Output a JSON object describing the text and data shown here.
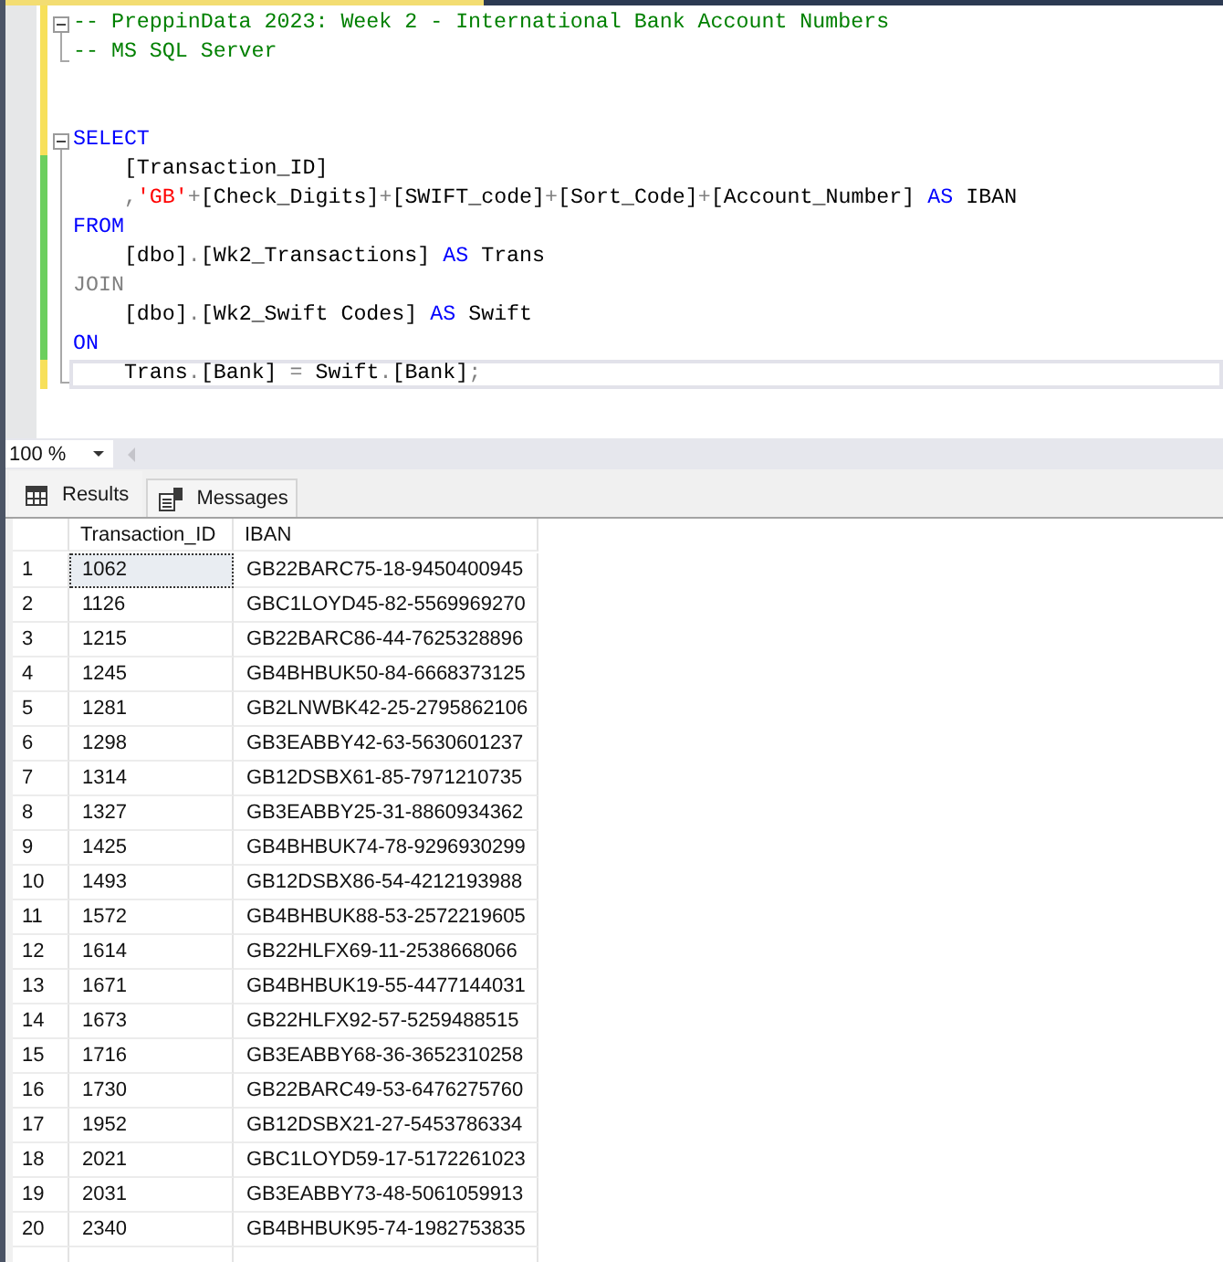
{
  "editor": {
    "blocks": [
      {
        "expanded": true,
        "lines": [
          {
            "saved": false,
            "current": false,
            "tokens": [
              {
                "kind": "comment",
                "text": "-- PreppinData 2023: Week 2 - International Bank Account Numbers"
              }
            ]
          },
          {
            "saved": false,
            "current": false,
            "tokens": [
              {
                "kind": "comment",
                "text": "-- MS SQL Server"
              }
            ]
          }
        ]
      },
      {
        "lines": [
          {
            "saved": false
          },
          {
            "saved": false
          }
        ]
      },
      {
        "expanded": true,
        "lines": [
          {
            "saved": false,
            "current": false,
            "tokens": [
              {
                "kind": "keyword",
                "text": "SELECT"
              }
            ]
          },
          {
            "saved": true,
            "current": false,
            "tokens": [
              {
                "kind": "identifier",
                "text": "    [Transaction_ID]"
              }
            ]
          },
          {
            "saved": true,
            "current": false,
            "tokens": [
              {
                "kind": "operator",
                "text": "    ,"
              },
              {
                "kind": "string",
                "text": "'GB'"
              },
              {
                "kind": "operator",
                "text": "+"
              },
              {
                "kind": "identifier",
                "text": "[Check_Digits]"
              },
              {
                "kind": "operator",
                "text": "+"
              },
              {
                "kind": "identifier",
                "text": "[SWIFT_code]"
              },
              {
                "kind": "operator",
                "text": "+"
              },
              {
                "kind": "identifier",
                "text": "[Sort_Code]"
              },
              {
                "kind": "operator",
                "text": "+"
              },
              {
                "kind": "identifier",
                "text": "[Account_Number] "
              },
              {
                "kind": "keyword",
                "text": "AS"
              },
              {
                "kind": "identifier",
                "text": " IBAN"
              }
            ]
          },
          {
            "saved": true,
            "current": false,
            "tokens": [
              {
                "kind": "keyword",
                "text": "FROM"
              }
            ]
          },
          {
            "saved": true,
            "current": false,
            "tokens": [
              {
                "kind": "identifier",
                "text": "    [dbo]"
              },
              {
                "kind": "operator",
                "text": "."
              },
              {
                "kind": "identifier",
                "text": "[Wk2_Transactions] "
              },
              {
                "kind": "keyword",
                "text": "AS"
              },
              {
                "kind": "identifier",
                "text": " Trans"
              }
            ]
          },
          {
            "saved": true,
            "current": false,
            "tokens": [
              {
                "kind": "operator",
                "text": "JOIN"
              }
            ]
          },
          {
            "saved": true,
            "current": false,
            "tokens": [
              {
                "kind": "identifier",
                "text": "    [dbo]"
              },
              {
                "kind": "operator",
                "text": "."
              },
              {
                "kind": "identifier",
                "text": "[Wk2_Swift Codes] "
              },
              {
                "kind": "keyword",
                "text": "AS"
              },
              {
                "kind": "identifier",
                "text": " Swift"
              }
            ]
          },
          {
            "saved": true,
            "current": false,
            "tokens": [
              {
                "kind": "keyword",
                "text": "ON"
              }
            ]
          },
          {
            "saved": false,
            "current": true,
            "tokens": [
              {
                "kind": "identifier",
                "text": "    Trans"
              },
              {
                "kind": "operator",
                "text": "."
              },
              {
                "kind": "identifier",
                "text": "[Bank] "
              },
              {
                "kind": "operator",
                "text": "="
              },
              {
                "kind": "identifier",
                "text": " Swift"
              },
              {
                "kind": "operator",
                "text": "."
              },
              {
                "kind": "identifier",
                "text": "[Bank]"
              },
              {
                "kind": "operator",
                "text": ";"
              }
            ]
          }
        ]
      }
    ]
  },
  "zoom": {
    "value": "100 %"
  },
  "result_tabs": [
    {
      "label": "Results",
      "selected": true
    },
    {
      "label": "Messages",
      "selected": false
    }
  ],
  "results": {
    "columns": [
      "Transaction_ID",
      "IBAN"
    ],
    "rows": [
      {
        "number": "1",
        "selected": true,
        "cells": [
          "1062",
          "GB22BARC75-18-9450400945"
        ]
      },
      {
        "number": "2",
        "selected": false,
        "cells": [
          "1126",
          "GBC1LOYD45-82-5569969270"
        ]
      },
      {
        "number": "3",
        "selected": false,
        "cells": [
          "1215",
          "GB22BARC86-44-7625328896"
        ]
      },
      {
        "number": "4",
        "selected": false,
        "cells": [
          "1245",
          "GB4BHBUK50-84-6668373125"
        ]
      },
      {
        "number": "5",
        "selected": false,
        "cells": [
          "1281",
          "GB2LNWBK42-25-2795862106"
        ]
      },
      {
        "number": "6",
        "selected": false,
        "cells": [
          "1298",
          "GB3EABBY42-63-5630601237"
        ]
      },
      {
        "number": "7",
        "selected": false,
        "cells": [
          "1314",
          "GB12DSBX61-85-7971210735"
        ]
      },
      {
        "number": "8",
        "selected": false,
        "cells": [
          "1327",
          "GB3EABBY25-31-8860934362"
        ]
      },
      {
        "number": "9",
        "selected": false,
        "cells": [
          "1425",
          "GB4BHBUK74-78-9296930299"
        ]
      },
      {
        "number": "10",
        "selected": false,
        "cells": [
          "1493",
          "GB12DSBX86-54-4212193988"
        ]
      },
      {
        "number": "11",
        "selected": false,
        "cells": [
          "1572",
          "GB4BHBUK88-53-2572219605"
        ]
      },
      {
        "number": "12",
        "selected": false,
        "cells": [
          "1614",
          "GB22HLFX69-11-2538668066"
        ]
      },
      {
        "number": "13",
        "selected": false,
        "cells": [
          "1671",
          "GB4BHBUK19-55-4477144031"
        ]
      },
      {
        "number": "14",
        "selected": false,
        "cells": [
          "1673",
          "GB22HLFX92-57-5259488515"
        ]
      },
      {
        "number": "15",
        "selected": false,
        "cells": [
          "1716",
          "GB3EABBY68-36-3652310258"
        ]
      },
      {
        "number": "16",
        "selected": false,
        "cells": [
          "1730",
          "GB22BARC49-53-6476275760"
        ]
      },
      {
        "number": "17",
        "selected": false,
        "cells": [
          "1952",
          "GB12DSBX21-27-5453786334"
        ]
      },
      {
        "number": "18",
        "selected": false,
        "cells": [
          "2021",
          "GBC1LOYD59-17-5172261023"
        ]
      },
      {
        "number": "19",
        "selected": false,
        "cells": [
          "2031",
          "GB3EABBY73-48-5061059913"
        ]
      },
      {
        "number": "20",
        "selected": false,
        "cells": [
          "2340",
          "GB4BHBUK95-74-1982753835"
        ]
      }
    ]
  }
}
